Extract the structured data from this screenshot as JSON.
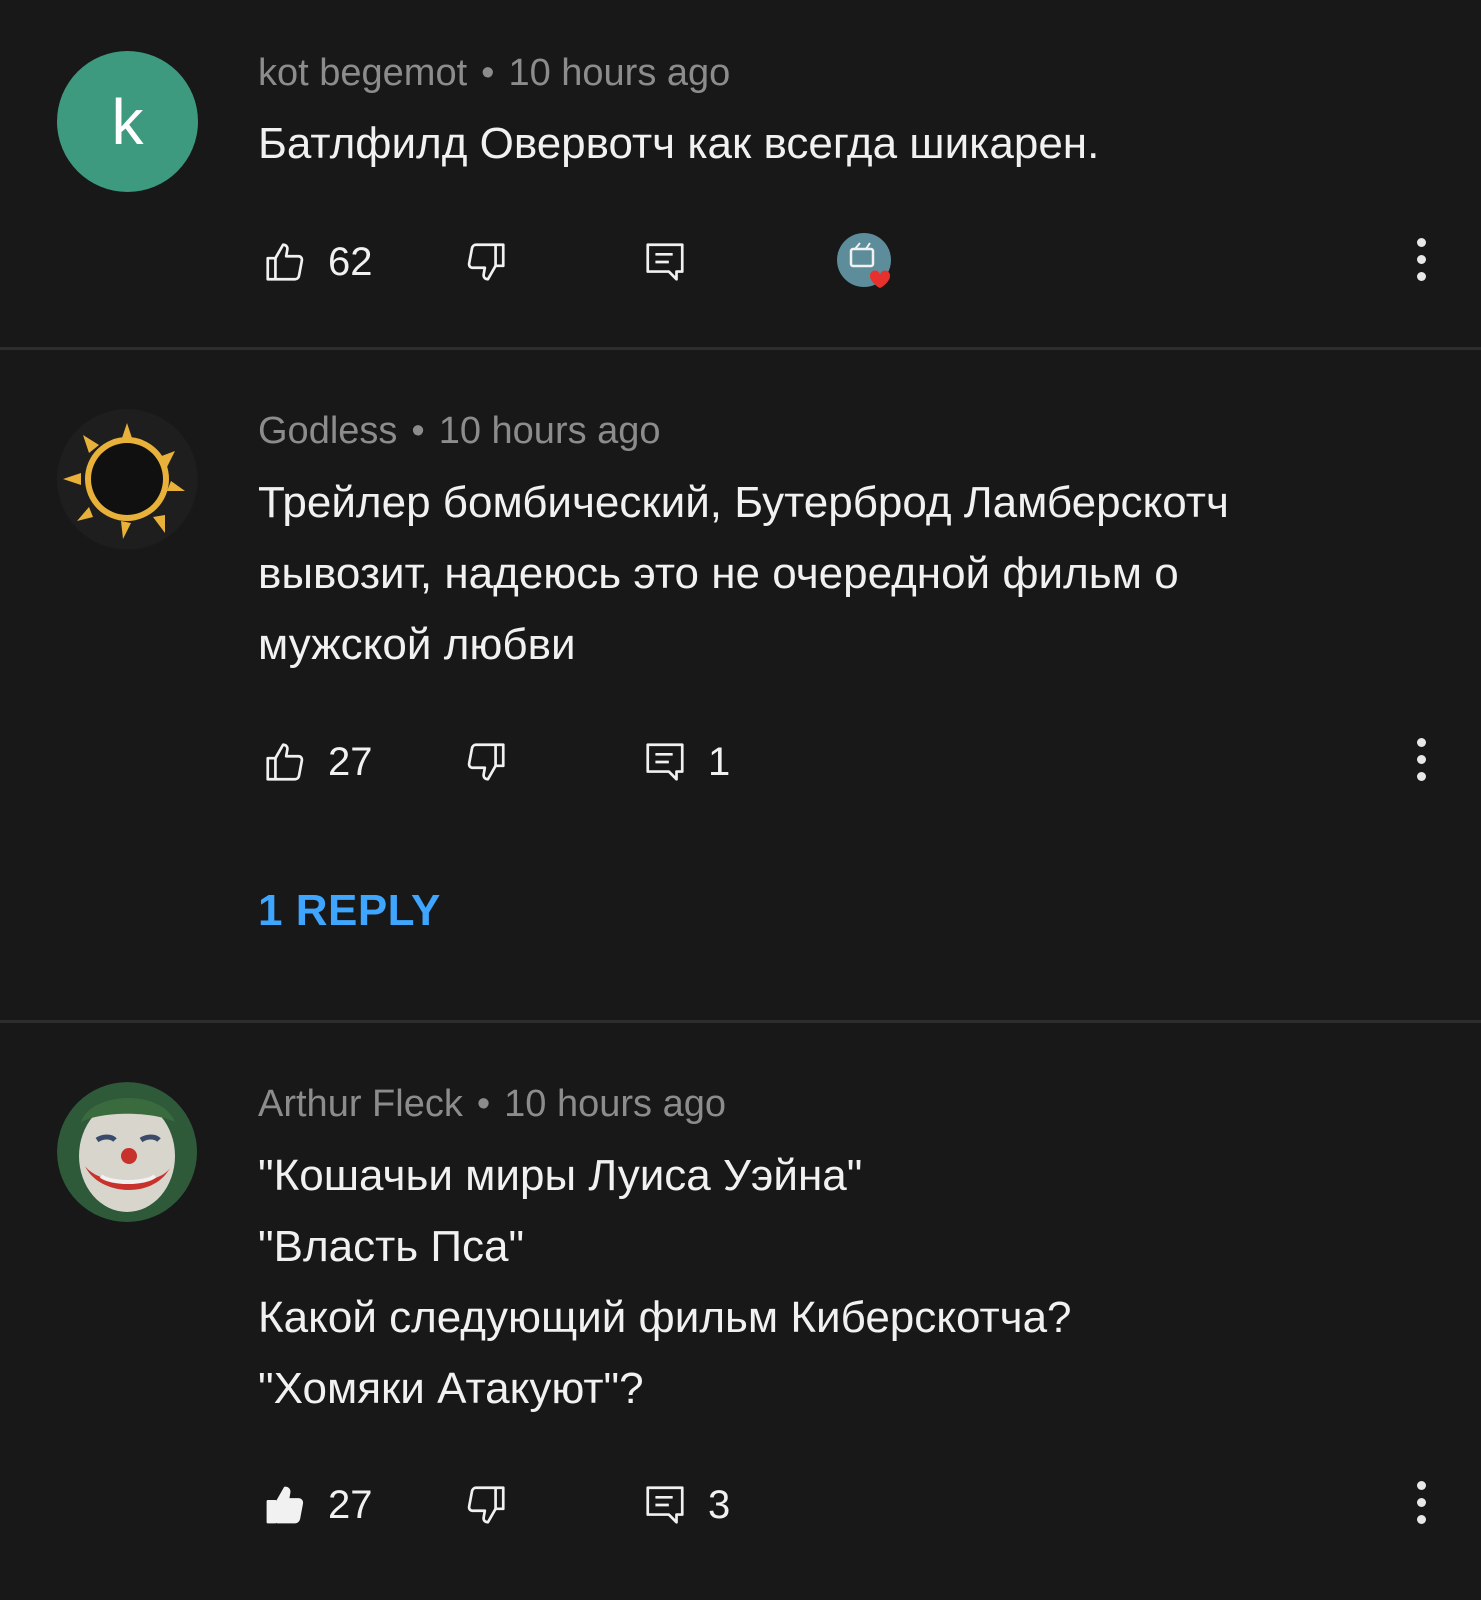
{
  "comments": [
    {
      "author": "kot begemot",
      "separator": "•",
      "time": "10 hours ago",
      "avatar_letter": "k",
      "text": "Батлфилд Овервотч как всегда шикарен.",
      "likes": "62",
      "replies_count": "",
      "creator_hearted": true
    },
    {
      "author": "Godless",
      "separator": "•",
      "time": "10 hours ago",
      "text": "Трейлер бомбический, Бутерброд Ламберскотч\nвывозит, надеюсь это не очередной фильм о\nмужской любви",
      "likes": "27",
      "replies_count": "1",
      "view_replies": "1 REPLY"
    },
    {
      "author": "Arthur Fleck",
      "separator": "•",
      "time": "10 hours ago",
      "text": "\"Кошачьи миры Луиса Уэйна\"\n\"Власть Пса\"\nКакой следующий фильм Киберскотча?\n\"Хомяки Атакуют\"?",
      "likes": "27",
      "replies_count": "3",
      "liked": true
    }
  ],
  "colors": {
    "background": "#181818",
    "meta_text": "#8c8c8c",
    "link_blue": "#3ea6ff",
    "avatar_teal": "#3d9a7e",
    "heart_red": "#e8302c"
  },
  "icons": [
    "thumb-up-icon",
    "thumb-down-icon",
    "reply-icon",
    "more-vert-icon",
    "heart-icon"
  ]
}
